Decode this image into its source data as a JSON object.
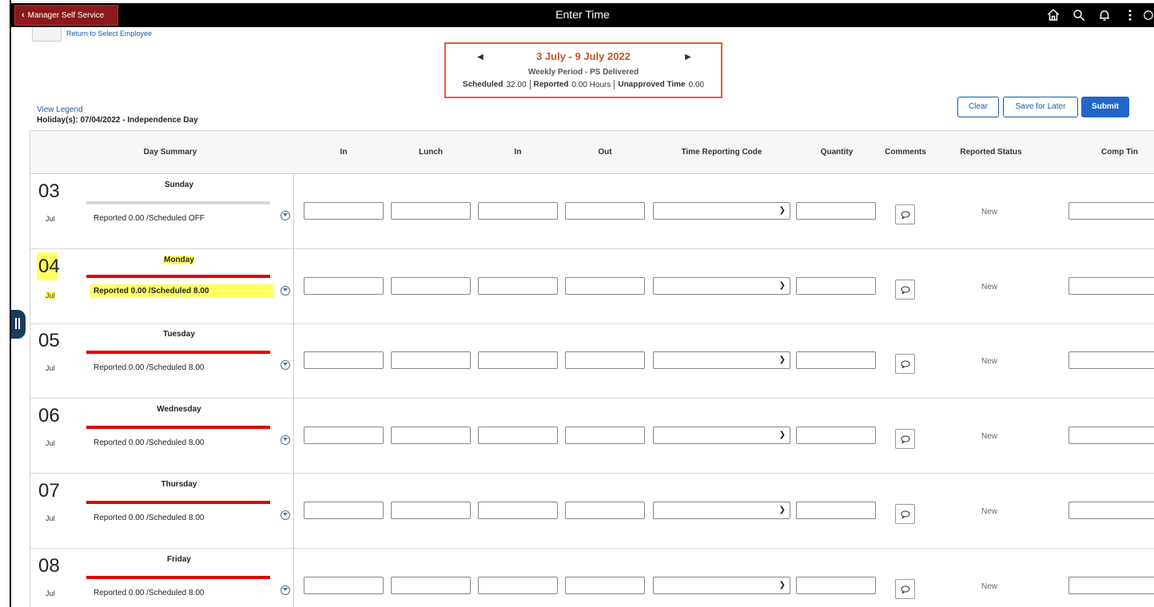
{
  "topbar": {
    "back_label": "Manager Self Service",
    "title": "Enter Time",
    "icons": [
      "home-icon",
      "search-icon",
      "bell-icon",
      "more-vertical-icon",
      "compass-icon"
    ]
  },
  "header": {
    "return_link": "Return to Select Employee",
    "period_title": "3 July - 9 July 2022",
    "period_subtitle": "Weekly Period - PS Delivered",
    "scheduled_label": "Scheduled",
    "scheduled_value": "32.00",
    "reported_label": "Reported",
    "reported_value": "0.00 Hours",
    "unapproved_label": "Unapproved Time",
    "unapproved_value": "0.00",
    "view_legend": "View Legend",
    "holiday": "Holiday(s): 07/04/2022 - Independence Day"
  },
  "actions": {
    "clear": "Clear",
    "save_for_later": "Save for Later",
    "submit": "Submit"
  },
  "columns": {
    "day_summary": "Day Summary",
    "in1": "In",
    "lunch": "Lunch",
    "in2": "In",
    "out": "Out",
    "trc": "Time Reporting Code",
    "quantity": "Quantity",
    "comments": "Comments",
    "reported_status": "Reported Status",
    "comp_time": "Comp Tin"
  },
  "rows": [
    {
      "day": "03",
      "month": "Jul",
      "weekday": "Sunday",
      "reported": "Reported 0.00 /Scheduled OFF",
      "status": "New"
    },
    {
      "day": "04",
      "month": "Jul",
      "weekday": "Monday",
      "reported": "Reported 0.00 /Scheduled 8.00",
      "status": "New"
    },
    {
      "day": "05",
      "month": "Jul",
      "weekday": "Tuesday",
      "reported": "Reported 0.00 /Scheduled 8.00",
      "status": "New"
    },
    {
      "day": "06",
      "month": "Jul",
      "weekday": "Wednesday",
      "reported": "Reported 0.00 /Scheduled 8.00",
      "status": "New"
    },
    {
      "day": "07",
      "month": "Jul",
      "weekday": "Thursday",
      "reported": "Reported 0.00 /Scheduled 8.00",
      "status": "New"
    },
    {
      "day": "08",
      "month": "Jul",
      "weekday": "Friday",
      "reported": "Reported 0.00 /Scheduled 8.00",
      "status": "New"
    }
  ],
  "colors": {
    "accent": "#2266c8",
    "period_border": "#e8553e",
    "period_title": "#c0562a",
    "shortfall_bar": "#e00000",
    "highlight": "#ffff66",
    "back_button": "#8b1a1a"
  }
}
